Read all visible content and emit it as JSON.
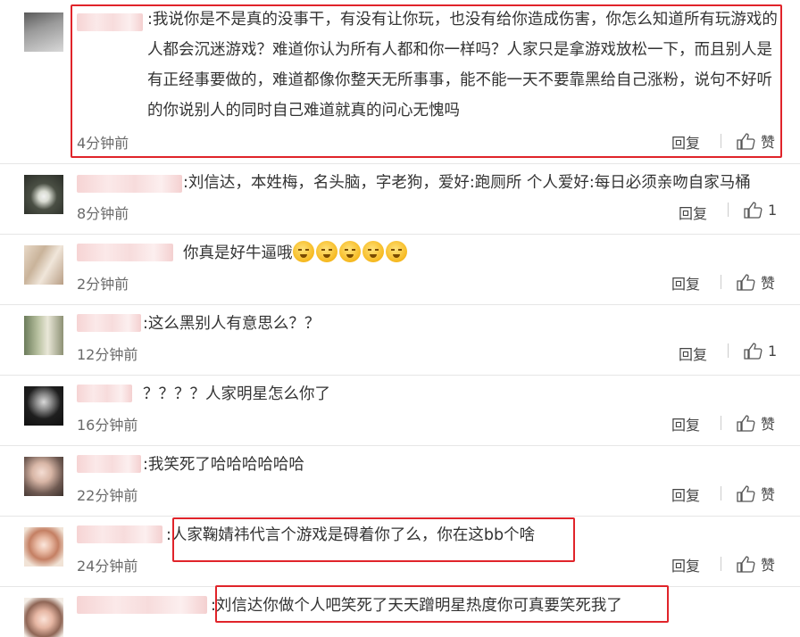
{
  "comments": [
    {
      "text": ":我说你是不是真的没事干，有没有让你玩，也没有给你造成伤害，你怎么知道所有玩游戏的人都会沉迷游戏？难道你认为所有人都和你一样吗？人家只是拿游戏放松一下，而且别人是有正经事要做的，难道都像你整天无所事事，能不能一天不要靠黑给自己涨粉，说句不好听的你说别人的同时自己难道就真的问心无愧吗",
      "time": "4分钟前",
      "reply": "回复",
      "like": "赞"
    },
    {
      "text": ":刘信达，本姓梅，名头脑，字老狗，爱好:跑厕所 个人爱好:每日必须亲吻自家马桶",
      "time": "8分钟前",
      "reply": "回复",
      "like": "1"
    },
    {
      "text": "你真是好牛逼哦",
      "time": "2分钟前",
      "reply": "回复",
      "like": "赞"
    },
    {
      "text": ":这么黑别人有意思么？？",
      "time": "12分钟前",
      "reply": "回复",
      "like": "1"
    },
    {
      "text": "？？？？人家明星怎么你了",
      "time": "16分钟前",
      "reply": "回复",
      "like": "赞"
    },
    {
      "text": ":我笑死了哈哈哈哈哈哈",
      "time": "22分钟前",
      "reply": "回复",
      "like": "赞"
    },
    {
      "text": ":人家鞠婧祎代言个游戏是碍着你了么，你在这bb个啥",
      "time": "24分钟前",
      "reply": "回复",
      "like": "赞"
    },
    {
      "text": ":刘信达你做个人吧笑死了天天蹭明星热度你可真要笑死我了"
    }
  ],
  "icons": {
    "like": "thumbs-up-icon",
    "emoji": "grimace-emoji-icon"
  },
  "colors": {
    "highlight": "#e0242a",
    "text": "#333333",
    "meta": "#6a6a6a"
  }
}
